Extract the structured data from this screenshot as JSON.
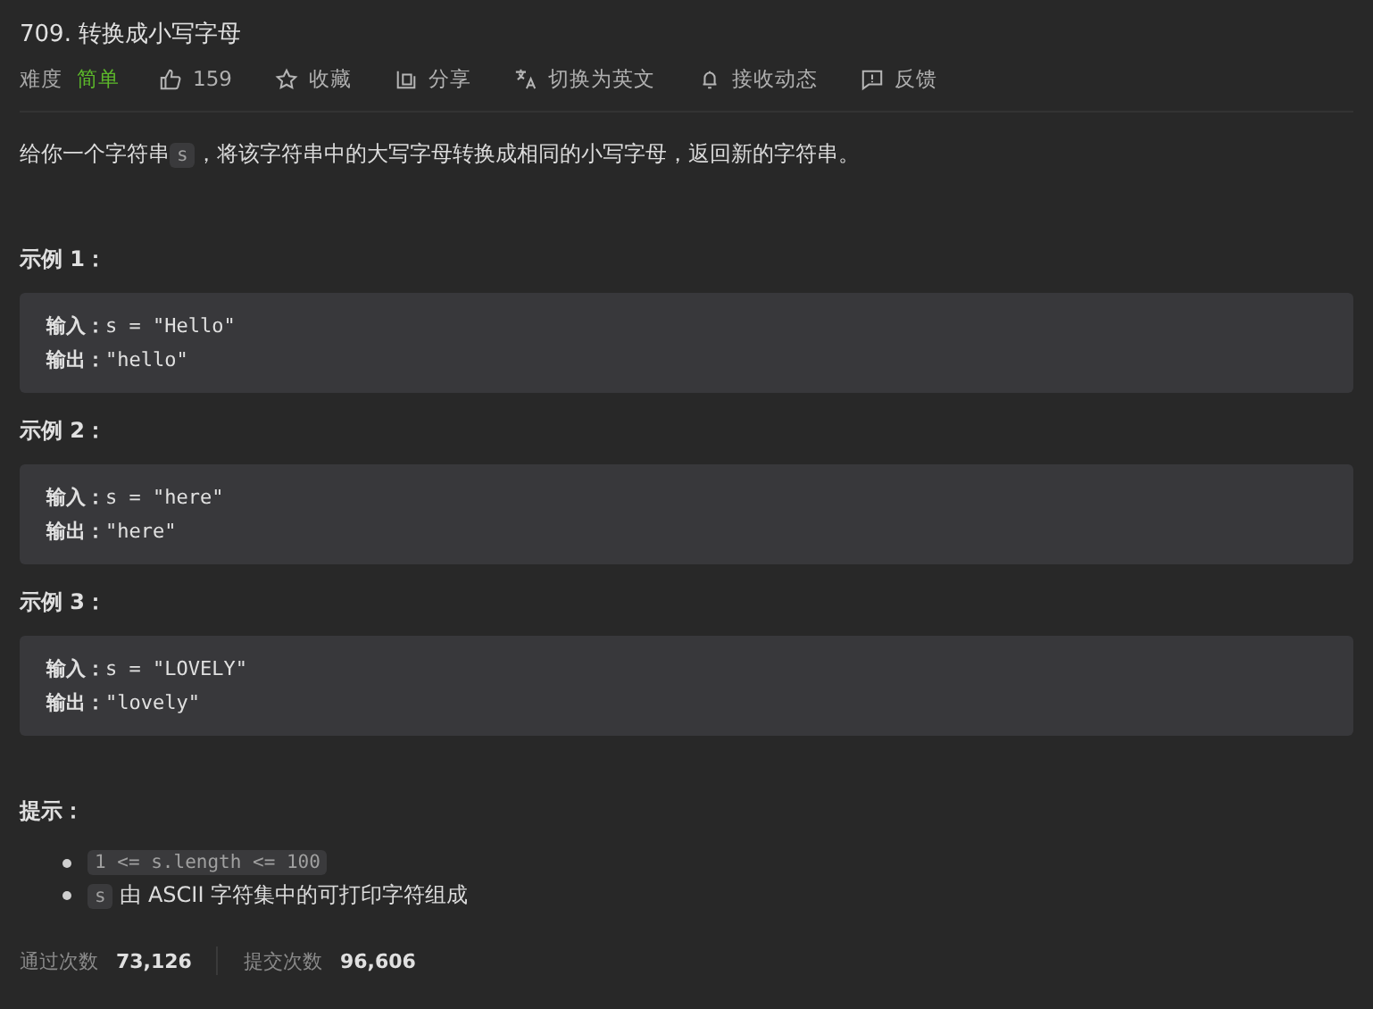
{
  "title": "709. 转换成小写字母",
  "meta": {
    "difficulty_label": "难度",
    "difficulty": "简单",
    "actions": [
      {
        "kind": "like",
        "label": "159"
      },
      {
        "kind": "star",
        "label": "收藏"
      },
      {
        "kind": "share",
        "label": "分享"
      },
      {
        "kind": "translate",
        "label": "切换为英文"
      },
      {
        "kind": "bell",
        "label": "接收动态"
      },
      {
        "kind": "feedback",
        "label": "反馈"
      }
    ]
  },
  "description": {
    "before": "给你一个字符串",
    "code": "s",
    "after": "，将该字符串中的大写字母转换成相同的小写字母，返回新的字符串。"
  },
  "examples": [
    {
      "heading": "示例 1：",
      "input_label": "输入：",
      "input": "s = \"Hello\"",
      "output_label": "输出：",
      "output": "\"hello\""
    },
    {
      "heading": "示例 2：",
      "input_label": "输入：",
      "input": "s = \"here\"",
      "output_label": "输出：",
      "output": "\"here\""
    },
    {
      "heading": "示例 3：",
      "input_label": "输入：",
      "input": "s = \"LOVELY\"",
      "output_label": "输出：",
      "output": "\"lovely\""
    }
  ],
  "hints": {
    "heading": "提示：",
    "items": [
      {
        "code": "1 <= s.length <= 100"
      },
      {
        "code": "s",
        "text": "由 ASCII 字符集中的可打印字符组成"
      }
    ]
  },
  "stats": [
    {
      "label": "通过次数",
      "value": "73,126"
    },
    {
      "label": "提交次数",
      "value": "96,606"
    }
  ]
}
